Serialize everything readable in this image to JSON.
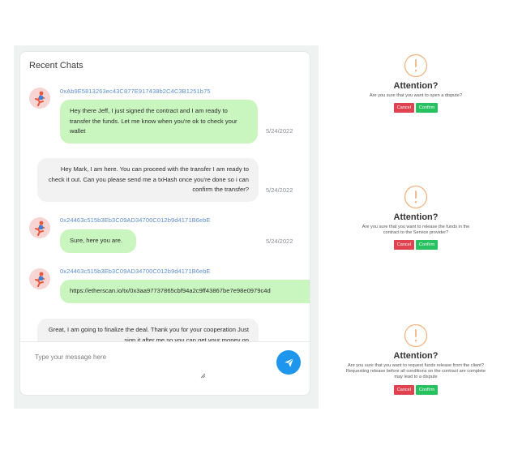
{
  "chat": {
    "title": "Recent Chats",
    "messages": [
      {
        "sender": "0xAb9E5813263ec43C877E917438b2C4C3B1251b75",
        "text": "Hey there Jeff, I just signed the contract and I am ready to transfer the funds. Let me know when you're ok to check your wallet",
        "date": "5/24/2022"
      },
      {
        "text": "Hey Mark, I am here. You can proceed with the transfer I am ready to check it out. Can you please send me a txHash once you're done so i can confirm the transfer?",
        "date": "5/24/2022"
      },
      {
        "sender": "0x24463c515b3Eb3C09AD34700C012b9d4171B6ebE",
        "text": "Sure, here you are.",
        "date": "5/24/2022"
      },
      {
        "sender": "0x24463c515b3Eb3C09AD34700C012b9d4171B6ebE",
        "text": "https://etherscan.io/tx/0x3aa97737865cbf94a2c9ff43867be7e98e0979c4d"
      },
      {
        "text": "Great, I am going to finalize the deal. Thank you for your cooperation Just sign it after me so you can get your money on"
      }
    ],
    "composer": {
      "placeholder": "Type your message here"
    }
  },
  "dialogs": [
    {
      "title": "Attention?",
      "text": "Are you sure that you want to open a dispute?",
      "cancel_label": "Cancel",
      "confirm_label": "Confirm"
    },
    {
      "title": "Attention?",
      "text": "Are you sure that you want to release the funds in the contract to the Service provider?",
      "cancel_label": "Cancel",
      "confirm_label": "Confirm"
    },
    {
      "title": "Attention?",
      "text": "Are you sure that you want to request funds release from the client? Requesting release before all conditions on the contract are complete may lead to a dispute",
      "cancel_label": "Cancel",
      "confirm_label": "Confirm"
    }
  ],
  "colors": {
    "incoming_bubble": "#c9f5bf",
    "outgoing_bubble": "#f2f2f2",
    "sender_address": "#5d8fd3",
    "send_button": "#1e96ee",
    "warning_icon": "#f2b483",
    "cancel_button": "#e0424f",
    "confirm_button": "#27c160"
  },
  "icons": {
    "avatar": "runner-avatar-icon",
    "send": "paper-plane-icon",
    "warning": "exclamation-circle-icon",
    "resize": "resize-grip-icon"
  }
}
